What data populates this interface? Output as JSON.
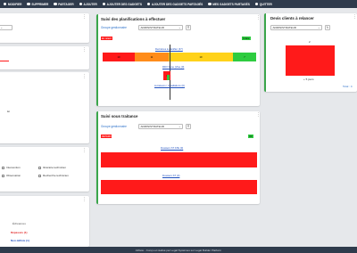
{
  "toolbar": {
    "items": [
      {
        "icon": "settings-icon",
        "label": "MODIFIER"
      },
      {
        "icon": "delete-icon",
        "label": "SUPPRIMER"
      },
      {
        "icon": "share-icon",
        "label": "PARTAGER"
      },
      {
        "icon": "add-icon",
        "label": "AJOUTER"
      },
      {
        "icon": "add-gadgets-icon",
        "label": "AJOUTER DES GADGETS"
      },
      {
        "icon": "add-shared-gadgets-icon",
        "label": "AJOUTER DES GADGETS PARTAGÉS"
      },
      {
        "icon": "my-shared-gadgets-icon",
        "label": "MES GADGETS PARTAGÉS"
      },
      {
        "icon": "quit-icon",
        "label": "QUITTER"
      }
    ]
  },
  "left": {
    "filters": [
      "Intervention",
      "Observation"
    ],
    "filters_right": [
      "Itinéraire technicien",
      "Recherche technicien"
    ],
    "partial_text": "lei",
    "bottom_items": [
      "Échéances",
      "Dépassés (1)",
      "Non définis (1)"
    ]
  },
  "planif": {
    "title": "Suivi des planifications à effectuer",
    "group_label": "Groupe gestionnaire",
    "group_value": "ADMINISTRATEUR",
    "tag_late": "En retard",
    "tag_todo": "À faire",
    "segments": [
      "10",
      "11",
      "19",
      "7"
    ],
    "link1": "Dernières à planifier (47)",
    "link2": "RDV Pose (Vise (0)",
    "link3": "Livraisons / Installations (0)",
    "marker": "1"
  },
  "soustraitance": {
    "title": "Suivi sous traitance",
    "group_label": "Groupe gestionnaire",
    "group_value": "ADMINISTRATEUR",
    "tag_late": "RETARD",
    "tag_ok": "OK",
    "link1": "Dossiers ST ATE (0)",
    "link2": "Dossiers ST (0)"
  },
  "devis": {
    "title": "Devis clients à relancer",
    "group_value": "ADMINISTRATEUR",
    "value": "2",
    "sublabel": "+ 5 jours",
    "total": "Total : 4"
  },
  "footer": {
    "text": "Athlete - Conçu et réalisé par Legal Systèmes sur Legal Builder Platform"
  },
  "colors": {
    "red": "#ff1a1a",
    "orange": "#ff8c1a",
    "yellow": "#ffd21a",
    "green": "#2ecc40",
    "header": "#2f3b4c"
  }
}
